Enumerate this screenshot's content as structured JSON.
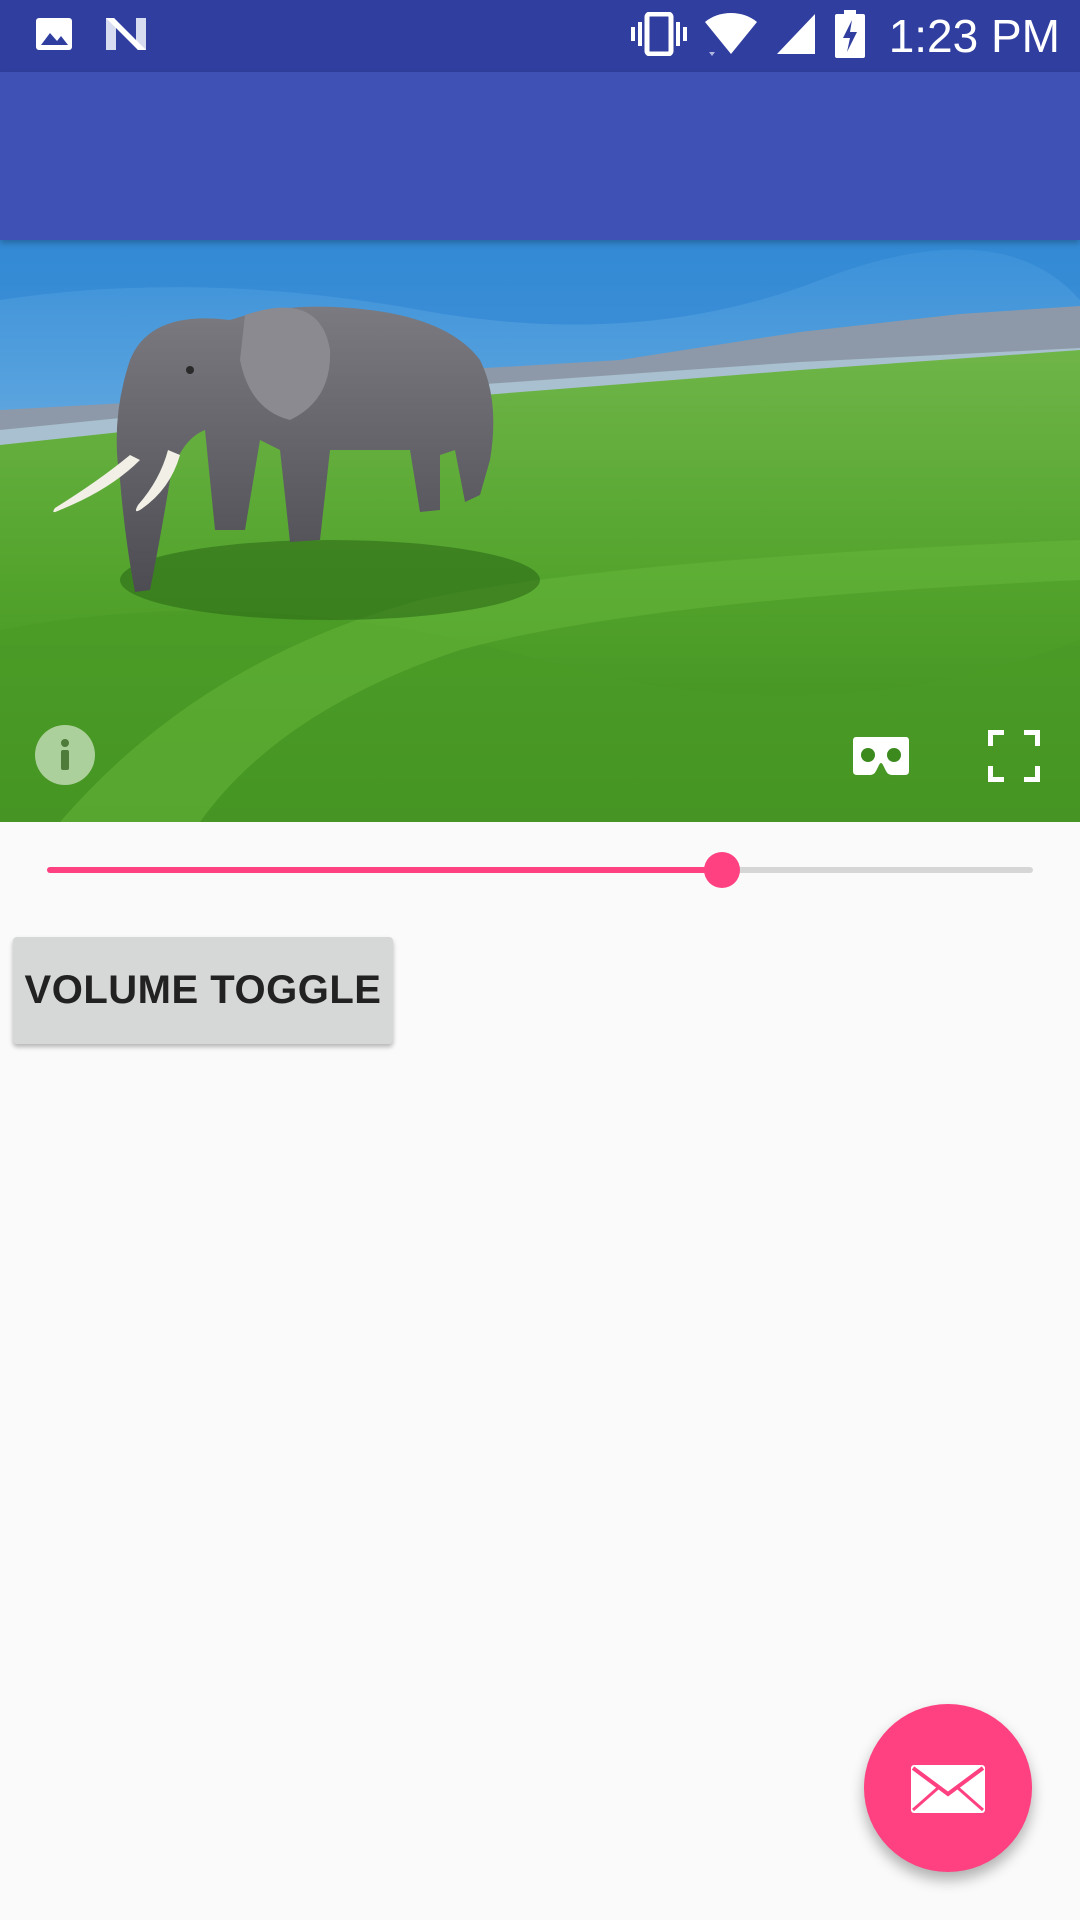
{
  "status_bar": {
    "time": "1:23 PM",
    "left_icons": [
      "image-icon",
      "n-logo-icon"
    ],
    "right_icons": [
      "vibrate-icon",
      "wifi-icon",
      "signal-icon",
      "battery-charging-icon"
    ],
    "background_color": "#303f9f"
  },
  "app_bar": {
    "title": "",
    "background_color": "#3f51b5"
  },
  "video_view": {
    "scene": "elephant-on-grassland",
    "controls": [
      "info-icon",
      "cardboard-vr-icon",
      "fullscreen-icon"
    ]
  },
  "seekbar": {
    "progress": 0.685,
    "accent_color": "#ff4081",
    "track_color": "#d6d6d6"
  },
  "volume_button": {
    "label": "VOLUME TOGGLE"
  },
  "fab": {
    "icon": "mail-icon",
    "color": "#ff4081"
  }
}
